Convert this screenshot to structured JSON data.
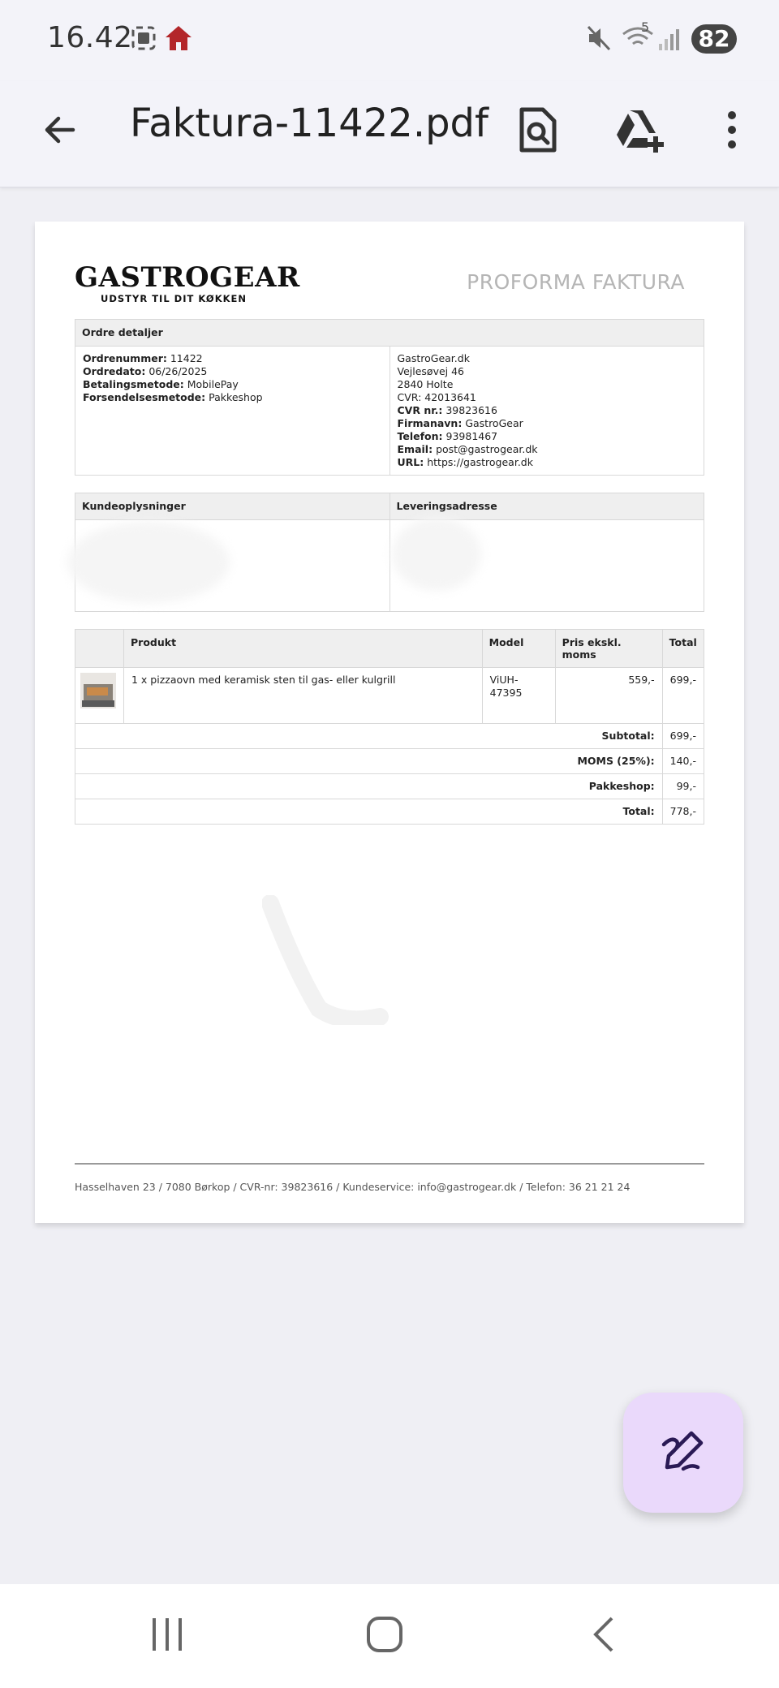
{
  "status_bar": {
    "time": "16.42",
    "icons": [
      "screenshot-icon",
      "home-icon",
      "mute-icon",
      "wifi-icon",
      "signal-icon"
    ],
    "wifi_badge": "5",
    "battery": "82"
  },
  "app_bar": {
    "title": "Faktura-11422.pdf",
    "icons": [
      "back-arrow-icon",
      "search-document-icon",
      "drive-add-icon",
      "more-vert-icon"
    ]
  },
  "invoice": {
    "logo_main": "GASTROGEAR",
    "logo_sub": "UDSTYR TIL DIT KØKKEN",
    "doc_title": "PROFORMA FAKTURA",
    "order_details": {
      "header": "Ordre detaljer",
      "left": [
        {
          "label": "Ordrenummer:",
          "value": "11422"
        },
        {
          "label": "Ordredato:",
          "value": "06/26/2025"
        },
        {
          "label": "Betalingsmetode:",
          "value": "MobilePay"
        },
        {
          "label": "Forsendelsesmetode:",
          "value": "Pakkeshop"
        }
      ],
      "right_plain": [
        "GastroGear.dk",
        "Vejlesøvej 46",
        "2840 Holte",
        "CVR: 42013641"
      ],
      "right_labeled": [
        {
          "label": "CVR nr.:",
          "value": "39823616"
        },
        {
          "label": "Firmanavn:",
          "value": "GastroGear"
        },
        {
          "label": "Telefon:",
          "value": "93981467"
        },
        {
          "label": "Email:",
          "value": "post@gastrogear.dk"
        },
        {
          "label": "URL:",
          "value": "https://gastrogear.dk"
        }
      ]
    },
    "customer": {
      "header_left": "Kundeoplysninger",
      "header_right": "Leveringsadresse"
    },
    "products": {
      "headers": [
        "",
        "Produkt",
        "Model",
        "Pris ekskl. moms",
        "Total"
      ],
      "rows": [
        {
          "name": "1 x pizzaovn med keramisk sten til gas- eller kulgrill",
          "model": "ViUH-47395",
          "price": "559,-",
          "total": "699,-"
        }
      ],
      "totals": [
        {
          "label": "Subtotal:",
          "value": "699,-"
        },
        {
          "label": "MOMS (25%):",
          "value": "140,-"
        },
        {
          "label": "Pakkeshop:",
          "value": "99,-"
        },
        {
          "label": "Total:",
          "value": "778,-"
        }
      ]
    },
    "footer": "Hasselhaven 23 / 7080 Børkop / CVR-nr: 39823616 / Kundeservice: info@gastrogear.dk / Telefon: 36 21 21 24"
  },
  "fab": {
    "icon": "edit-pen-icon",
    "color": "#ead9fb"
  },
  "nav_bar": {
    "icons": [
      "recent-apps-icon",
      "home-button-icon",
      "back-icon"
    ]
  }
}
